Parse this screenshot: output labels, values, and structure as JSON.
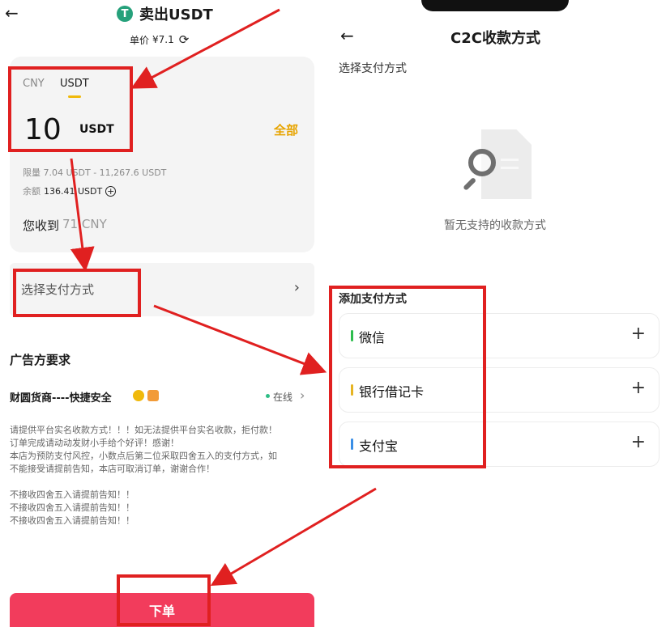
{
  "left": {
    "title": "卖出USDT",
    "token_logo_letter": "T",
    "price_label": "单价",
    "price_value": "¥7.1",
    "amount_card": {
      "tab_cny": "CNY",
      "tab_usdt": "USDT",
      "amount": "10",
      "amount_unit": "USDT",
      "all_label": "全部",
      "limit_label": "限量",
      "limit_value": "7.04 USDT - 11,267.6 USDT",
      "balance_label": "余额",
      "balance_value": "136.41 USDT",
      "receive_label": "您收到",
      "receive_value": "71 CNY"
    },
    "payment_select_label": "选择支付方式",
    "advertiser_title": "广告方要求",
    "merchant_name": "财圆货商----快捷安全",
    "online_label": "在线",
    "requirements": [
      "请提供平台实名收款方式！！！如无法提供平台实名收款，拒付款！",
      "订单完成请动动发财小手给个好评！感谢！",
      "本店为预防支付风控，小数点后第二位采取四舍五入的支付方式，如",
      "不能接受请提前告知，本店可取消订单，谢谢合作！",
      "",
      "不接收四舍五入请提前告知！！",
      "不接收四舍五入请提前告知！！",
      "不接收四舍五入请提前告知！！"
    ],
    "order_button": "下单"
  },
  "right": {
    "title": "C2C收款方式",
    "subtitle": "选择支付方式",
    "empty_text": "暂无支持的收款方式",
    "add_title": "添加支付方式",
    "methods": [
      {
        "label": "微信",
        "color": "#2ebd4e"
      },
      {
        "label": "银行借记卡",
        "color": "#e6b422"
      },
      {
        "label": "支付宝",
        "color": "#3a8ee6"
      }
    ]
  },
  "colors": {
    "accent_red": "#f23c5c",
    "annotation_red": "#e02020",
    "gold": "#e7a400"
  },
  "icons": {
    "back": "back-arrow-icon",
    "refresh": "refresh-icon",
    "chevron": "chevron-right-icon",
    "plus": "plus-icon",
    "empty": "search-document-icon"
  }
}
